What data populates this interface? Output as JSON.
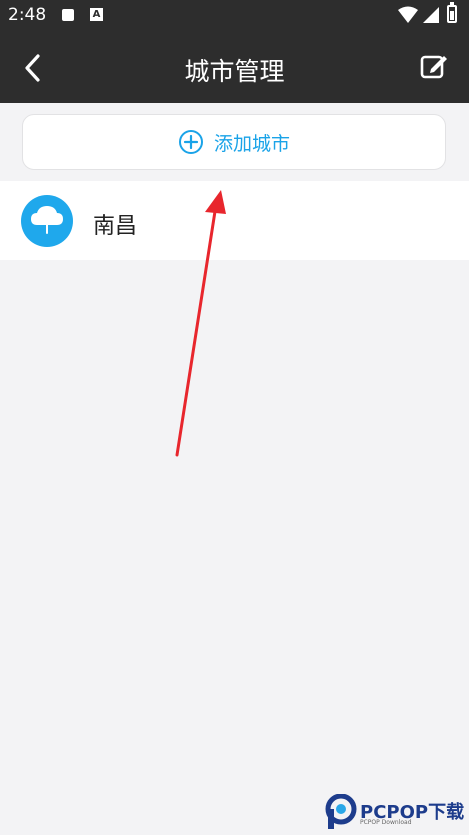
{
  "status_bar": {
    "time": "2:48",
    "icons": [
      "notification-square-icon",
      "a-icon",
      "wifi-icon",
      "signal-icon",
      "battery-icon"
    ],
    "a_glyph": "A"
  },
  "header": {
    "title": "城市管理",
    "back_icon": "chevron-left-icon",
    "edit_icon": "edit-icon",
    "background": "#2d2d2d"
  },
  "add_city": {
    "label": "添加城市",
    "icon": "plus-circle-icon",
    "color": "#1aa3e8"
  },
  "cities": [
    {
      "name": "南昌",
      "icon": "cloud-rain-icon",
      "icon_color": "#1fa8ec"
    }
  ],
  "annotation": {
    "type": "arrow",
    "color": "#e8262d"
  },
  "watermark": {
    "text": "PCPOP下载",
    "sub": "PCPOP Download"
  }
}
